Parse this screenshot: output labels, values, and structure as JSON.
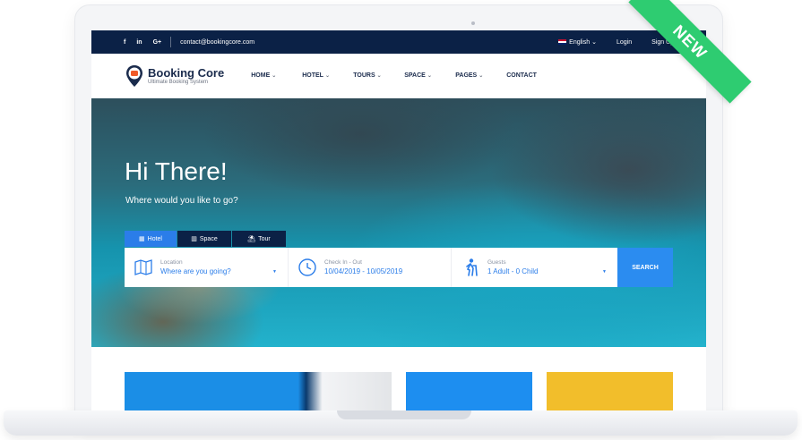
{
  "topbar": {
    "social": [
      "f",
      "in",
      "G+"
    ],
    "email": "contact@bookingcore.com",
    "language": "English",
    "login": "Login",
    "signup": "Sign Up"
  },
  "brand": {
    "name": "Booking Core",
    "tagline": "Ultimate Booking System"
  },
  "menu": [
    "HOME",
    "HOTEL",
    "TOURS",
    "SPACE",
    "PAGES",
    "CONTACT"
  ],
  "hero": {
    "title": "Hi There!",
    "subtitle": "Where would you like to go?"
  },
  "tabs": [
    {
      "label": "Hotel",
      "icon": "building-icon"
    },
    {
      "label": "Space",
      "icon": "space-icon"
    },
    {
      "label": "Tour",
      "icon": "tour-icon"
    }
  ],
  "search": {
    "location_label": "Location",
    "location_value": "Where are you going?",
    "check_label": "Check In - Out",
    "check_value": "10/04/2019 - 10/05/2019",
    "guests_label": "Guests",
    "guests_value": "1 Adult - 0 Child",
    "button": "SEARCH"
  },
  "ribbon": "NEW",
  "colors": {
    "navy": "#0b2146",
    "accent": "#2b7de9",
    "ribbon": "#2ecc71",
    "card_yellow": "#f2be2b"
  }
}
